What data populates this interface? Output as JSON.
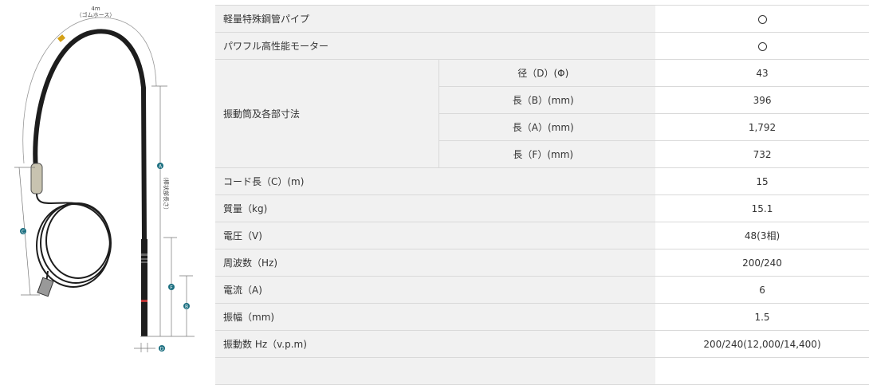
{
  "diagram": {
    "hose_length": "4m",
    "hose_note": "（ゴムホース）",
    "rod_note": "（棒状部長さ）",
    "dim_letters": {
      "A": "A",
      "B": "B",
      "C": "C",
      "D": "D",
      "F": "F"
    }
  },
  "spec": {
    "rows": [
      {
        "label": "軽量特殊鋼管パイプ",
        "value": "○"
      },
      {
        "label": "パワフル高性能モーター",
        "value": "○"
      },
      {
        "group": "振動筒及各部寸法",
        "sub": [
          {
            "label": "径（D）(Φ)",
            "value": "43"
          },
          {
            "label": "長（B）(mm)",
            "value": "396"
          },
          {
            "label": "長（A）(mm)",
            "value": "1,792"
          },
          {
            "label": "長（F）(mm)",
            "value": "732"
          }
        ]
      },
      {
        "label": "コード長（C）(m)",
        "value": "15"
      },
      {
        "label": "質量（kg)",
        "value": "15.1"
      },
      {
        "label": "電圧（V)",
        "value": "48(3相)"
      },
      {
        "label": "周波数（Hz)",
        "value": "200/240"
      },
      {
        "label": "電流（A)",
        "value": "6"
      },
      {
        "label": "振幅（mm)",
        "value": "1.5"
      },
      {
        "label": "振動数 Hz（v.p.m)",
        "value": "200/240(12,000/14,400)"
      }
    ]
  }
}
